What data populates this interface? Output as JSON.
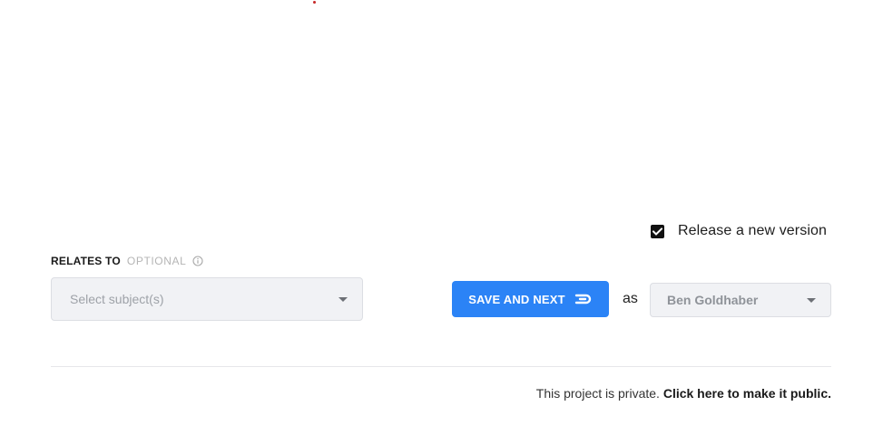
{
  "release": {
    "checked": true,
    "label": "Release a new version"
  },
  "relates_to": {
    "title": "RELATES TO",
    "optional": "OPTIONAL",
    "info_icon": "info-circle-icon",
    "placeholder": "Select subject(s)"
  },
  "save": {
    "label": "SAVE AND NEXT",
    "icon": "enter-return-icon",
    "color": "#2b83f6"
  },
  "as_label": "as",
  "user_select": {
    "value": "Ben Goldhaber"
  },
  "footer": {
    "text": "This project is private.",
    "link": "Click here to make it public."
  }
}
